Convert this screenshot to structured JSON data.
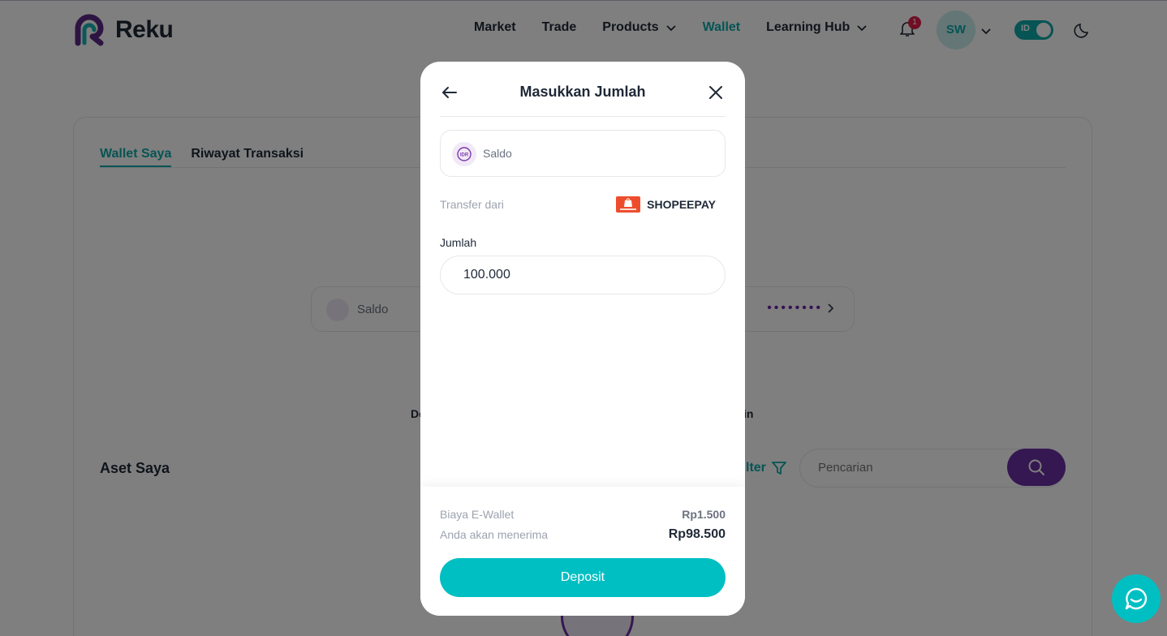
{
  "brand": {
    "name": "Reku"
  },
  "nav": {
    "items": [
      {
        "label": "Market"
      },
      {
        "label": "Trade"
      },
      {
        "label": "Products"
      },
      {
        "label": "Wallet"
      },
      {
        "label": "Learning Hub"
      }
    ],
    "notification_count": "1",
    "avatar_initials": "SW",
    "language": "ID"
  },
  "page": {
    "tabs": [
      {
        "label": "Wallet Saya"
      },
      {
        "label": "Riwayat Transaksi"
      }
    ],
    "saldo_label": "Saldo",
    "saldo_masked": "••••••••",
    "partial_text_left": "De",
    "partial_text_right": "in",
    "assets_title": "Aset Saya",
    "filter_label": "lter",
    "search_placeholder": "Pencarian"
  },
  "modal": {
    "title": "Masukkan Jumlah",
    "wallet_label": "Saldo",
    "transfer_label": "Transfer dari",
    "method_name": "SHOPEEPAY",
    "amount_label": "Jumlah",
    "amount_value": "100.000",
    "fee_label": "Biaya E-Wallet",
    "fee_value": "Rp1.500",
    "receive_label": "Anda akan menerima",
    "receive_value": "Rp98.500",
    "deposit_label": "Deposit"
  },
  "colors": {
    "accent": "#00bfc2",
    "nav_active": "#0fa8a8",
    "brand_purple": "#6b2fa3",
    "shopeepay": "#ee4d2d"
  }
}
